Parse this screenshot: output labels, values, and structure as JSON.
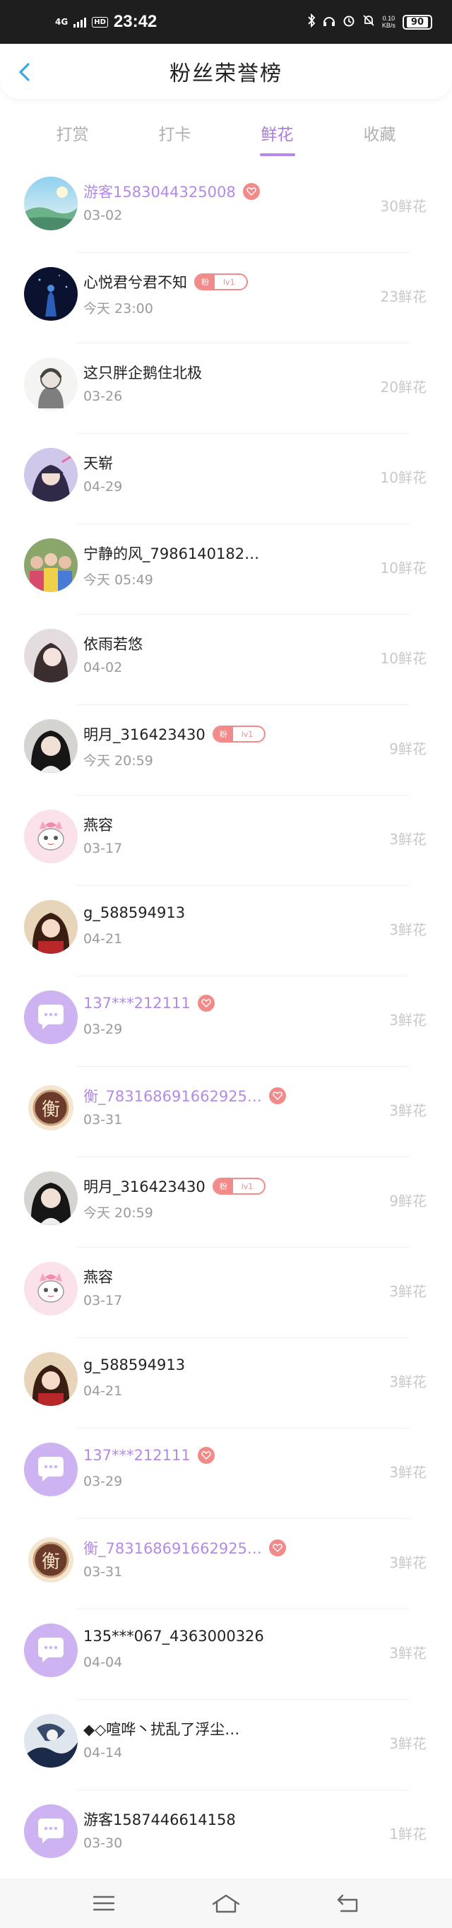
{
  "status_bar": {
    "network": "4G",
    "hd": "HD",
    "time": "23:42",
    "speed_value": "0.10",
    "speed_unit": "KB/s",
    "battery": "90"
  },
  "header": {
    "title": "粉丝荣誉榜"
  },
  "tabs": [
    {
      "label": "打赏"
    },
    {
      "label": "打卡"
    },
    {
      "label": "鲜花",
      "active": true
    },
    {
      "label": "收藏"
    }
  ],
  "list": [
    {
      "name": "游客1583044325008",
      "purple": true,
      "badge": "heart",
      "date": "03-02",
      "amount": "30鲜花",
      "avatar": "landscape"
    },
    {
      "name": "心悦君兮君不知",
      "badge": "fan",
      "fan_label": "粉",
      "level": "lv1",
      "date": "今天 23:00",
      "amount": "23鲜花",
      "avatar": "night"
    },
    {
      "name": "这只胖企鹅住北极",
      "date": "03-26",
      "amount": "20鲜花",
      "avatar": "sketch"
    },
    {
      "name": "天崭",
      "date": "04-29",
      "amount": "10鲜花",
      "avatar": "anime"
    },
    {
      "name": "宁静的风_7986140182…",
      "date": "今天 05:49",
      "amount": "10鲜花",
      "avatar": "group"
    },
    {
      "name": "依雨若悠",
      "date": "04-02",
      "amount": "10鲜花",
      "avatar": "girl"
    },
    {
      "name": "明月_316423430",
      "badge": "fan",
      "fan_label": "粉",
      "level": "lv1",
      "date": "今天 20:59",
      "amount": "9鲜花",
      "avatar": "woman"
    },
    {
      "name": "燕容",
      "date": "03-17",
      "amount": "3鲜花",
      "avatar": "cat"
    },
    {
      "name": "g_588594913",
      "date": "04-21",
      "amount": "3鲜花",
      "avatar": "costume"
    },
    {
      "name": "137***212111",
      "purple": true,
      "badge": "heart",
      "date": "03-29",
      "amount": "3鲜花",
      "avatar": "chat"
    },
    {
      "name": "衡_783168691662925…",
      "purple": true,
      "badge": "heart",
      "date": "03-31",
      "amount": "3鲜花",
      "avatar": "seal",
      "seal_char": "衡"
    },
    {
      "name": "明月_316423430",
      "badge": "fan",
      "fan_label": "粉",
      "level": "lv1",
      "date": "今天 20:59",
      "amount": "9鲜花",
      "avatar": "woman"
    },
    {
      "name": "燕容",
      "date": "03-17",
      "amount": "3鲜花",
      "avatar": "cat"
    },
    {
      "name": "g_588594913",
      "date": "04-21",
      "amount": "3鲜花",
      "avatar": "costume"
    },
    {
      "name": "137***212111",
      "purple": true,
      "badge": "heart",
      "date": "03-29",
      "amount": "3鲜花",
      "avatar": "chat"
    },
    {
      "name": "衡_783168691662925…",
      "purple": true,
      "badge": "heart",
      "date": "03-31",
      "amount": "3鲜花",
      "avatar": "seal",
      "seal_char": "衡"
    },
    {
      "name": "135***067_4363000326",
      "date": "04-04",
      "amount": "3鲜花",
      "avatar": "chat"
    },
    {
      "name": "◆◇喧哗丶扰乱了浮尘…",
      "date": "04-14",
      "amount": "3鲜花",
      "avatar": "ink"
    },
    {
      "name": "游客1587446614158",
      "date": "03-30",
      "amount": "1鲜花",
      "avatar": "chat"
    }
  ],
  "colors": {
    "accent": "#a97ae0",
    "badge": "#f28a8a",
    "purple_name": "#b38be6"
  },
  "icons": {
    "back": "chevron-left-icon",
    "nav": [
      "menu-icon",
      "home-icon",
      "return-icon"
    ]
  }
}
